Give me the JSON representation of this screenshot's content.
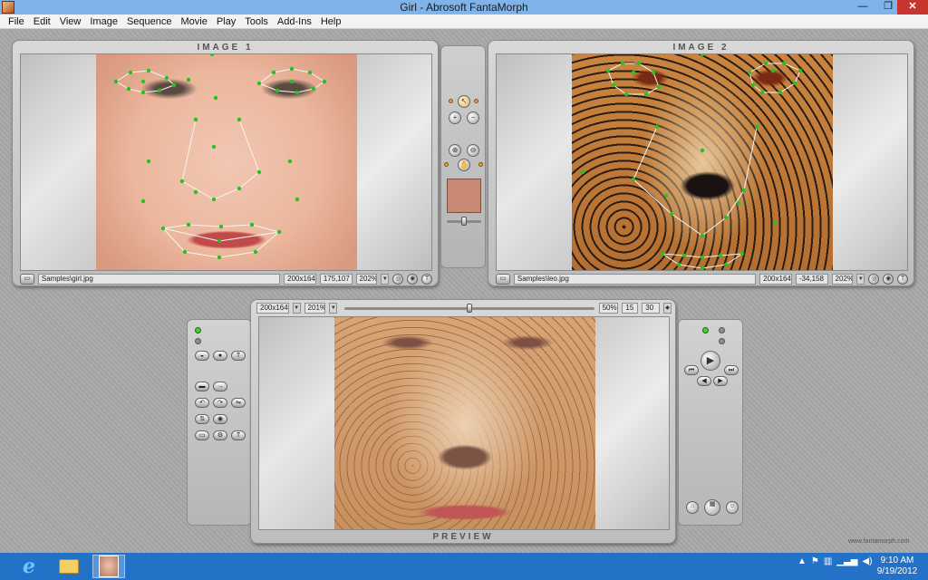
{
  "window": {
    "title": "Girl - Abrosoft FantaMorph",
    "min_glyph": "—",
    "max_glyph": "❐",
    "close_glyph": "✕"
  },
  "menu": [
    "File",
    "Edit",
    "View",
    "Image",
    "Sequence",
    "Movie",
    "Play",
    "Tools",
    "Add-Ins",
    "Help"
  ],
  "image1": {
    "title": "IMAGE 1",
    "path": "Samples\\girl.jpg",
    "size": "200x164",
    "coords": "175,107",
    "zoom": "202%"
  },
  "image2": {
    "title": "IMAGE 2",
    "path": "Samples\\leo.jpg",
    "size": "200x164",
    "coords": "-34,158",
    "zoom": "202%"
  },
  "preview": {
    "title": "PREVIEW",
    "size": "200x164",
    "zoom": "201%",
    "percent": "50%",
    "frame": "15",
    "total_frames": "30",
    "position": 0.5
  },
  "center_tools": {
    "blend": 0.5
  },
  "watermark": "www.fantamorph.com",
  "taskbar": {
    "time": "9:10 AM",
    "date": "9/19/2012"
  },
  "colors": {
    "titlebar": "#7fb3ea",
    "taskbar": "#2472c8",
    "keypoint": "#22c322"
  }
}
